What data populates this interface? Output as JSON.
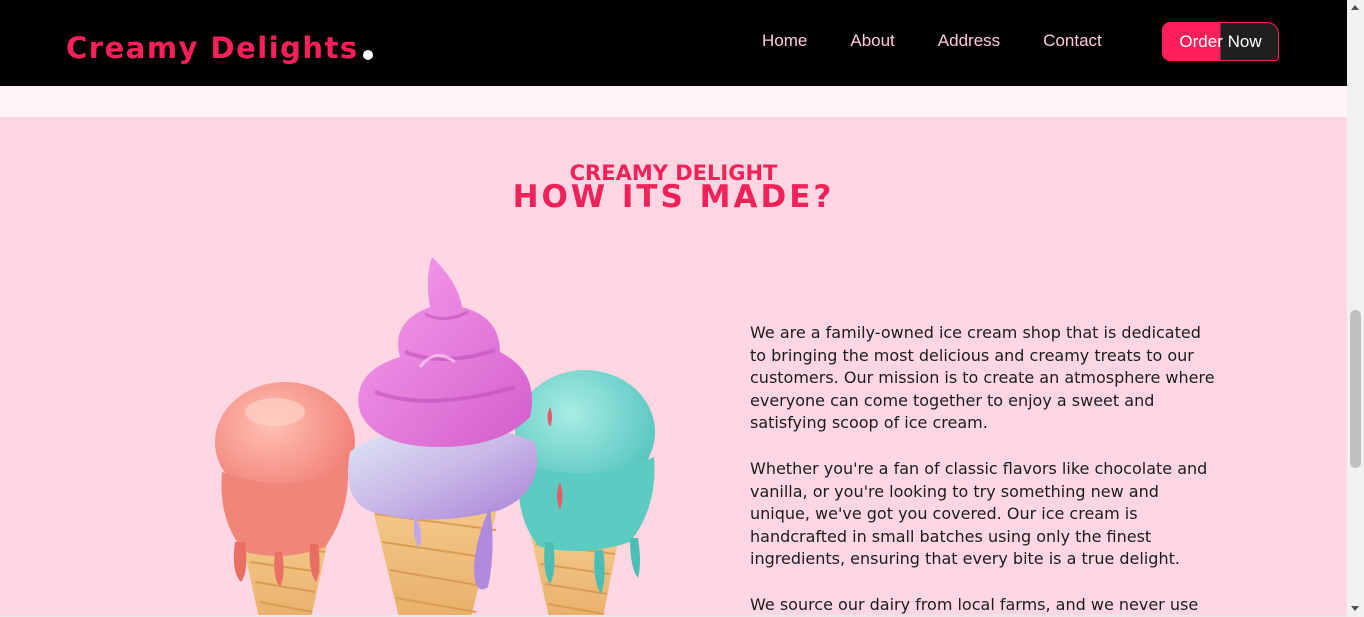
{
  "header": {
    "logo_text": "Creamy Delights",
    "nav": [
      {
        "label": "Home"
      },
      {
        "label": "About"
      },
      {
        "label": "Address"
      },
      {
        "label": "Contact"
      }
    ],
    "cta_label": "Order Now"
  },
  "section": {
    "kicker": "CREAMY DELIGHT",
    "headline": "HOW ITS MADE?",
    "paragraphs": [
      "We are a family-owned ice cream shop that is dedicated to bringing the most delicious and creamy treats to our customers. Our mission is to create an atmosphere where everyone can come together to enjoy a sweet and satisfying scoop of ice cream.",
      "Whether you're a fan of classic flavors like chocolate and vanilla, or you're looking to try something new and unique, we've got you covered. Our ice cream is handcrafted in small batches using only the finest ingredients, ensuring that every bite is a true delight.",
      "We source our dairy from local farms, and we never use"
    ]
  },
  "colors": {
    "brand": "#ff1f5a",
    "header_bg": "#000000",
    "section_bg": "#ffd6e1",
    "nav_text": "#ffc9d7"
  }
}
